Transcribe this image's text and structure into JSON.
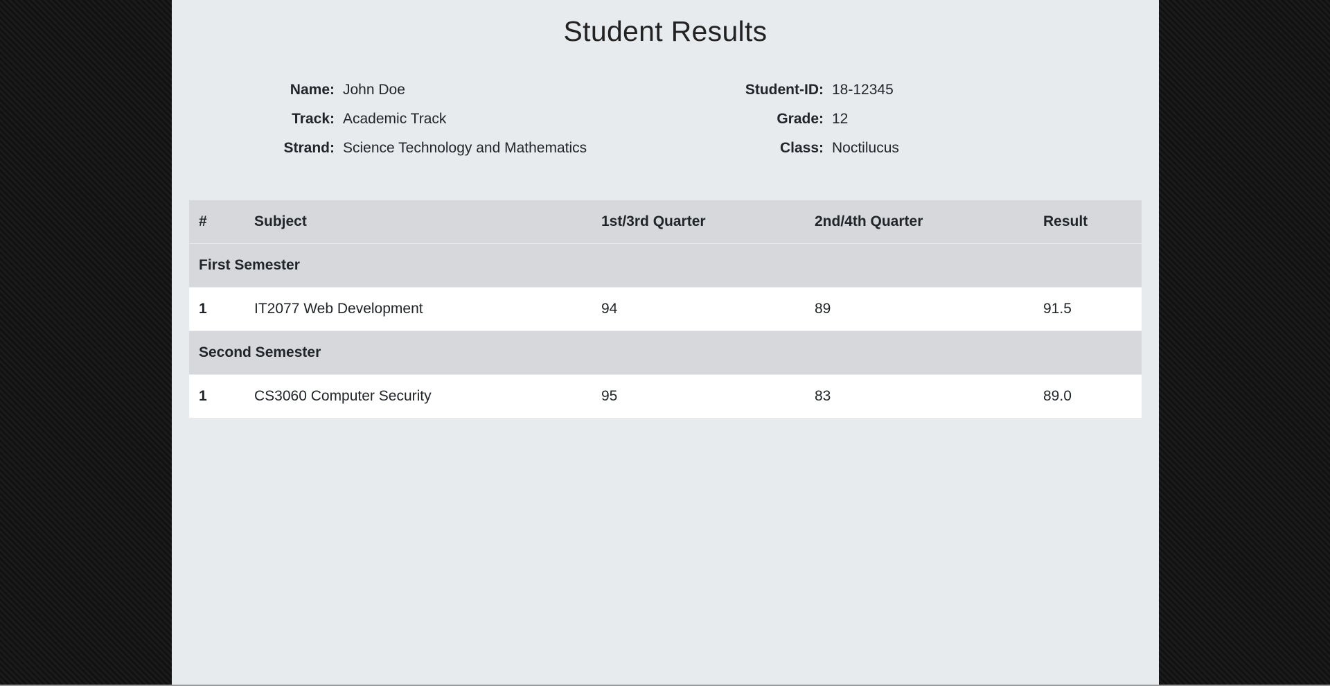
{
  "page_title": "Student Results",
  "student_info": {
    "left": [
      {
        "label": "Name:",
        "value": "John Doe"
      },
      {
        "label": "Track:",
        "value": "Academic Track"
      },
      {
        "label": "Strand:",
        "value": "Science Technology and Mathematics"
      }
    ],
    "right": [
      {
        "label": "Student-ID:",
        "value": "18-12345"
      },
      {
        "label": "Grade:",
        "value": "12"
      },
      {
        "label": "Class:",
        "value": "Noctilucus"
      }
    ]
  },
  "table": {
    "headers": [
      "#",
      "Subject",
      "1st/3rd Quarter",
      "2nd/4th Quarter",
      "Result"
    ],
    "sections": [
      {
        "title": "First Semester",
        "rows": [
          {
            "num": "1",
            "subject": "IT2077 Web Development",
            "q1": "94",
            "q2": "89",
            "result": "91.5"
          }
        ]
      },
      {
        "title": "Second Semester",
        "rows": [
          {
            "num": "1",
            "subject": "CS3060 Computer Security",
            "q1": "95",
            "q2": "83",
            "result": "89.0"
          }
        ]
      }
    ]
  },
  "colors": {
    "page_background": "#e8ebee",
    "header_background": "#d6d8db",
    "row_background": "#ffffff",
    "text": "#212529"
  }
}
